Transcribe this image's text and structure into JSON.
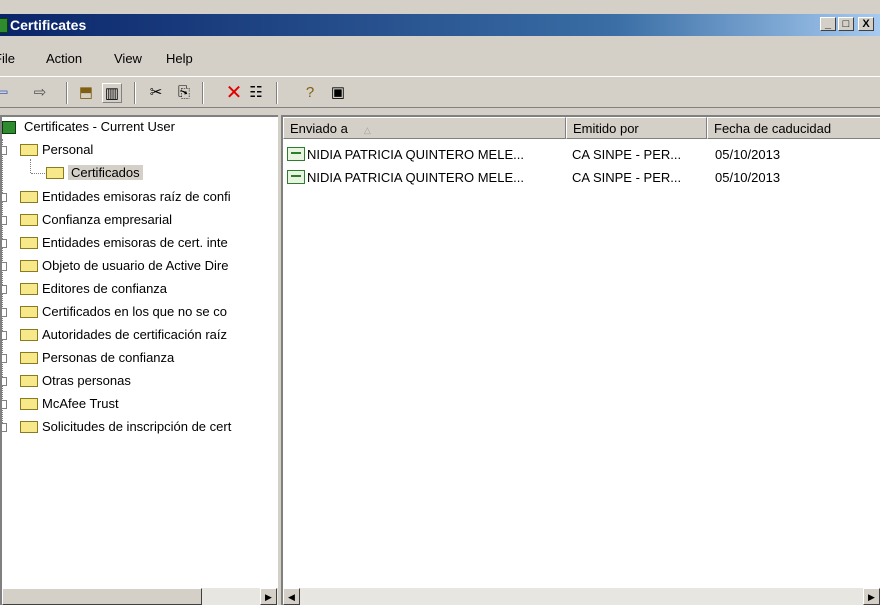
{
  "window": {
    "title": "Certificates",
    "minimize": "_",
    "maximize": "□",
    "close": "X"
  },
  "menu": {
    "file": "File",
    "action": "Action",
    "view": "View",
    "help": "Help"
  },
  "toolbar": {
    "back_icon": "back-arrow-icon",
    "forward_icon": "forward-arrow-icon",
    "up_icon": "up-folder-icon",
    "show_hide_tree_icon": "console-tree-icon",
    "cut_icon": "cut-icon",
    "copy_icon": "copy-icon",
    "delete_icon": "delete-icon",
    "properties_icon": "properties-icon",
    "help_icon": "help-icon",
    "export_icon": "export-list-icon"
  },
  "tree": {
    "root": "Certificates - Current User",
    "personal": "Personal",
    "personal_child": "Certificados",
    "items": [
      "Entidades emisoras raíz de confi",
      "Confianza empresarial",
      "Entidades emisoras de cert. inte",
      "Objeto de usuario de Active Dire",
      "Editores de confianza",
      "Certificados en los que no se co",
      "Autoridades de certificación raíz",
      "Personas de confianza",
      "Otras personas",
      "McAfee Trust",
      "Solicitudes de inscripción de cert"
    ]
  },
  "list": {
    "columns": [
      "Enviado a",
      "Emitido por",
      "Fecha de caducidad"
    ],
    "sort_indicator": "△",
    "rows": [
      {
        "issued_to": "NIDIA PATRICIA QUINTERO MELE...",
        "issued_by": "CA SINPE - PER...",
        "expiration": "05/10/2013"
      },
      {
        "issued_to": "NIDIA PATRICIA QUINTERO MELE...",
        "issued_by": "CA SINPE - PER...",
        "expiration": "05/10/2013"
      }
    ]
  },
  "colors": {
    "titlebar_start": "#0a246a",
    "titlebar_end": "#a6caf0",
    "chrome": "#d4d0c8",
    "folder": "#f7e98a"
  }
}
